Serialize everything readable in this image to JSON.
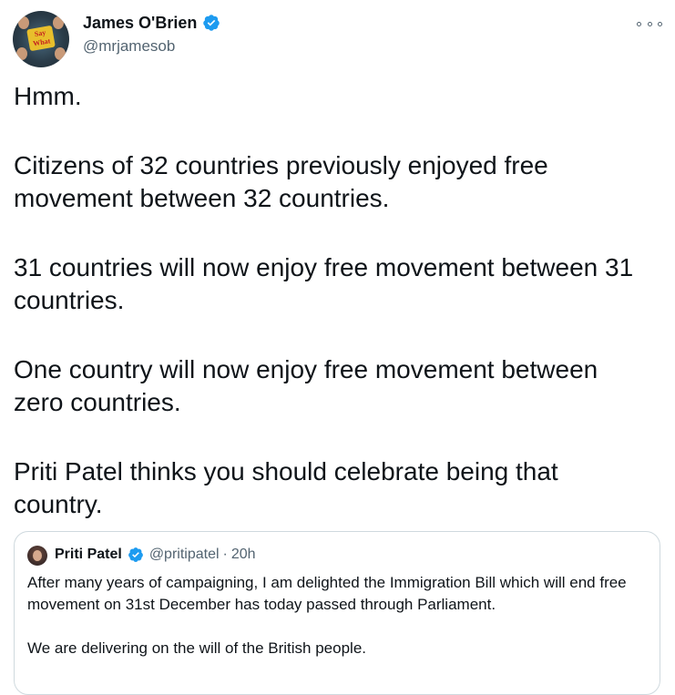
{
  "tweet": {
    "author_name": "James O'Brien",
    "author_handle": "@mrjamesob",
    "avatar_label": "Say What",
    "paragraphs": [
      "Hmm.",
      "Citizens of 32 countries previously enjoyed free\nmovement between 32 countries.",
      "31 countries will now enjoy free movement between 31\ncountries.",
      "One country will now enjoy free movement between\nzero countries.",
      "Priti Patel thinks you should celebrate being that\ncountry."
    ]
  },
  "quoted": {
    "author_name": "Priti Patel",
    "author_handle": "@pritipatel",
    "separator": "·",
    "time": "20h",
    "paragraphs": [
      "After many years of campaigning, I am delighted the Immigration Bill which will end free movement on 31st December has today passed through Parliament.",
      "We are delivering on the will of the British people."
    ]
  },
  "icons": {
    "verified": "verified-badge-icon",
    "more": "more-options-icon"
  },
  "colors": {
    "verified": "#1d9bf0",
    "text": "#0f1419",
    "secondary": "#536471",
    "border": "#cfd9de"
  }
}
